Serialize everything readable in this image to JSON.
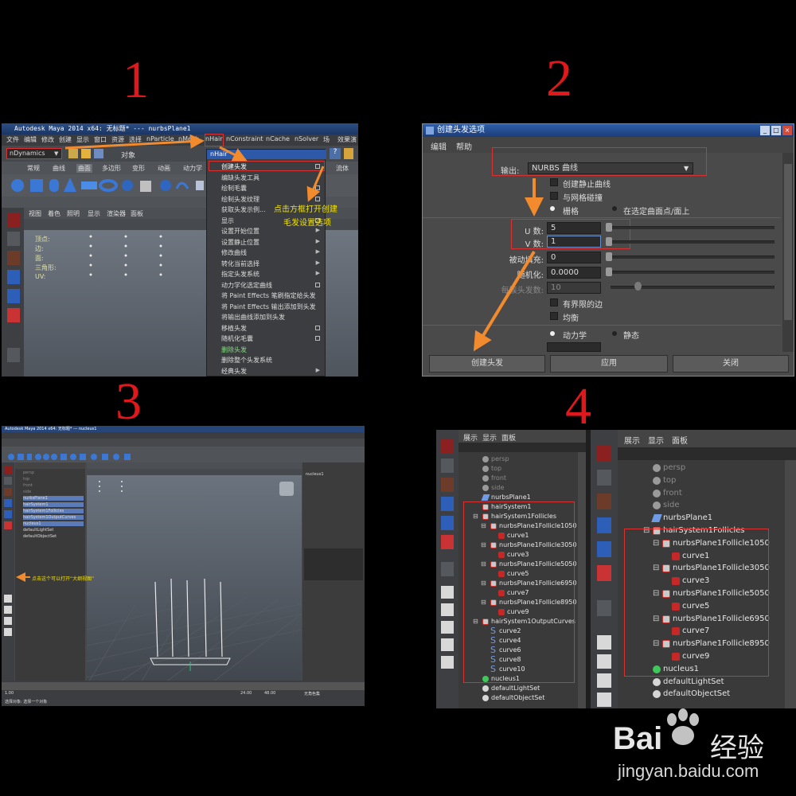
{
  "steps": [
    "1",
    "2",
    "3",
    "4"
  ],
  "panel1": {
    "window_title": "Autodesk Maya 2014 x64: 无标题*   ---   nurbsPlane1",
    "menu_bar": [
      "文件",
      "编辑",
      "修改",
      "创建",
      "显示",
      "窗口",
      "资源",
      "选择",
      "nParticle",
      "nMesh",
      "nHair",
      "nConstraint",
      "nCache",
      "nSolver",
      "场",
      "效果演"
    ],
    "mode_selector": "nDynamics",
    "object_label": "对象",
    "shelf_tabs": [
      "常规",
      "曲线",
      "曲面",
      "多边形",
      "变形",
      "动画",
      "动力学",
      "流体"
    ],
    "viewport_menu": [
      "视图",
      "着色",
      "照明",
      "显示",
      "渲染器",
      "面板"
    ],
    "stats_labels": [
      "顶点:",
      "边:",
      "面:",
      "三角形:",
      "UV:"
    ],
    "nhair_menu_title": "nHair",
    "nhair_menu_items": [
      "创建头发",
      "编缺头发工具",
      "绘制毛囊",
      "绘制头发纹理",
      "获取头发示例...",
      "显示",
      "设置开始位置",
      "设置静止位置",
      "修改曲线",
      "转化当前选择",
      "指定头发系统",
      "动力学化选定曲线",
      "将 Paint Effects 笔刷指定给头发",
      "将 Paint Effects 输出添加到头发",
      "将输出曲线添加到头发",
      "移植头发",
      "随机化毛囊",
      "删除头发",
      "删除整个头发系统",
      "经典头发"
    ],
    "annotation": [
      "点击方框打开创建",
      "毛发设置选项"
    ]
  },
  "panel2": {
    "window_title": "创建头发选项",
    "menu_bar": [
      "编辑",
      "帮助"
    ],
    "output_label": "输出:",
    "output_value": "NURBS 曲线",
    "checkboxes": [
      "创建静止曲线",
      "与网格碰撞"
    ],
    "radio_left": "栅格",
    "radio_right": "在选定曲面点/面上",
    "u_label": "U 数:",
    "u_value": "5",
    "v_label": "V 数:",
    "v_value": "1",
    "passive_label": "被动填充:",
    "passive_value": "0",
    "random_label": "随机化:",
    "random_value": "0.0000",
    "hairs_label": "每簇头发数:",
    "hairs_value": "10",
    "checkboxes2": [
      "有界限的边",
      "均衡"
    ],
    "radio2_left": "动力学",
    "radio2_right": "静态",
    "buttons": [
      "创建头发",
      "应用",
      "关闭"
    ]
  },
  "panel3": {
    "window_title": "Autodesk Maya 2014 x64: 无标题*   ---   nucleus1",
    "outliner_items": [
      "persp",
      "top",
      "front",
      "side",
      "nurbsPlane1",
      "hairSystem1",
      "hairSystem1Follicles",
      "hairSystem1OutputCurves",
      "nucleus1",
      "defaultLightSet",
      "defaultObjectSet"
    ],
    "annotation": "点击这个可以打开“大纲视图”",
    "right_panel_title": "nucleus1",
    "timeline_start": "1.00",
    "timeline_end": "24.00",
    "timeline_end2": "48.00",
    "no_char": "无角色集",
    "status_text": "选择对象: 选择一个对象"
  },
  "panel4": {
    "menu_bar": [
      "展示",
      "显示",
      "面板"
    ],
    "left_tree": [
      {
        "label": "persp",
        "depth": 0,
        "icon": "camera",
        "dim": true
      },
      {
        "label": "top",
        "depth": 0,
        "icon": "camera",
        "dim": true
      },
      {
        "label": "front",
        "depth": 0,
        "icon": "camera",
        "dim": true
      },
      {
        "label": "side",
        "depth": 0,
        "icon": "camera",
        "dim": true
      },
      {
        "label": "nurbsPlane1",
        "depth": 0,
        "icon": "plane"
      },
      {
        "label": "hairSystem1",
        "depth": 0,
        "icon": "hair"
      },
      {
        "label": "hairSystem1Follicles",
        "depth": 0,
        "icon": "hair",
        "toggle": "−"
      },
      {
        "label": "nurbsPlane1Follicle1050",
        "depth": 1,
        "icon": "hair",
        "toggle": "−"
      },
      {
        "label": "curve1",
        "depth": 2,
        "icon": "curve"
      },
      {
        "label": "nurbsPlane1Follicle3050",
        "depth": 1,
        "icon": "hair",
        "toggle": "−"
      },
      {
        "label": "curve3",
        "depth": 2,
        "icon": "curve"
      },
      {
        "label": "nurbsPlane1Follicle5050",
        "depth": 1,
        "icon": "hair",
        "toggle": "−"
      },
      {
        "label": "curve5",
        "depth": 2,
        "icon": "curve"
      },
      {
        "label": "nurbsPlane1Follicle6950",
        "depth": 1,
        "icon": "hair",
        "toggle": "−"
      },
      {
        "label": "curve7",
        "depth": 2,
        "icon": "curve"
      },
      {
        "label": "nurbsPlane1Follicle8950",
        "depth": 1,
        "icon": "hair",
        "toggle": "−"
      },
      {
        "label": "curve9",
        "depth": 2,
        "icon": "curve"
      },
      {
        "label": "hairSystem1OutputCurves",
        "depth": 0,
        "icon": "hair",
        "toggle": "−"
      },
      {
        "label": "curve2",
        "depth": 1,
        "icon": "scurve"
      },
      {
        "label": "curve4",
        "depth": 1,
        "icon": "scurve"
      },
      {
        "label": "curve6",
        "depth": 1,
        "icon": "scurve"
      },
      {
        "label": "curve8",
        "depth": 1,
        "icon": "scurve"
      },
      {
        "label": "curve10",
        "depth": 1,
        "icon": "scurve"
      },
      {
        "label": "nucleus1",
        "depth": 0,
        "icon": "nucleus"
      },
      {
        "label": "defaultLightSet",
        "depth": 0,
        "icon": "set"
      },
      {
        "label": "defaultObjectSet",
        "depth": 0,
        "icon": "set"
      }
    ],
    "right_tree": [
      {
        "label": "persp",
        "depth": 0,
        "icon": "camera",
        "dim": true
      },
      {
        "label": "top",
        "depth": 0,
        "icon": "camera",
        "dim": true
      },
      {
        "label": "front",
        "depth": 0,
        "icon": "camera",
        "dim": true
      },
      {
        "label": "side",
        "depth": 0,
        "icon": "camera",
        "dim": true
      },
      {
        "label": "nurbsPlane1",
        "depth": 0,
        "icon": "plane"
      },
      {
        "label": "hairSystem1Follicles",
        "depth": 0,
        "icon": "hair",
        "toggle": "−"
      },
      {
        "label": "nurbsPlane1Follicle1050",
        "depth": 1,
        "icon": "hair",
        "toggle": "−"
      },
      {
        "label": "curve1",
        "depth": 2,
        "icon": "curve"
      },
      {
        "label": "nurbsPlane1Follicle3050",
        "depth": 1,
        "icon": "hair",
        "toggle": "−"
      },
      {
        "label": "curve3",
        "depth": 2,
        "icon": "curve"
      },
      {
        "label": "nurbsPlane1Follicle5050",
        "depth": 1,
        "icon": "hair",
        "toggle": "−"
      },
      {
        "label": "curve5",
        "depth": 2,
        "icon": "curve"
      },
      {
        "label": "nurbsPlane1Follicle6950",
        "depth": 1,
        "icon": "hair",
        "toggle": "−"
      },
      {
        "label": "curve7",
        "depth": 2,
        "icon": "curve"
      },
      {
        "label": "nurbsPlane1Follicle8950",
        "depth": 1,
        "icon": "hair",
        "toggle": "−"
      },
      {
        "label": "curve9",
        "depth": 2,
        "icon": "curve"
      },
      {
        "label": "nucleus1",
        "depth": 0,
        "icon": "nucleus"
      },
      {
        "label": "defaultLightSet",
        "depth": 0,
        "icon": "set"
      },
      {
        "label": "defaultObjectSet",
        "depth": 0,
        "icon": "set"
      }
    ]
  },
  "watermark": {
    "brand": "Bai",
    "brand2": "经验",
    "url": "jingyan.baidu.com"
  },
  "colors": {
    "annotation_red": "#e0181c",
    "arrow_orange": "#f28a2e",
    "annotation_yellow": "#f2e200",
    "highlight_blue": "#2e58a8"
  }
}
